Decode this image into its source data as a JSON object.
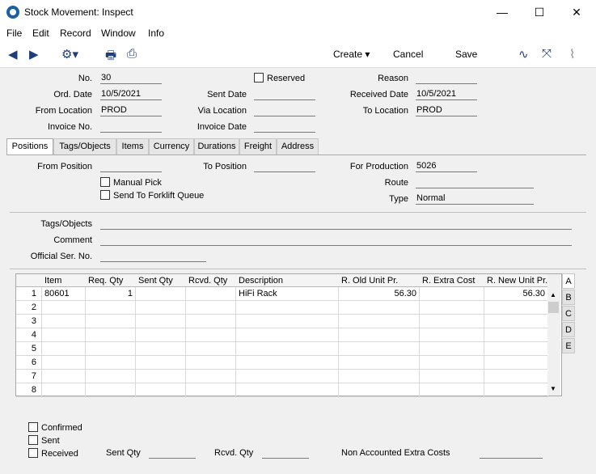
{
  "window": {
    "title": "Stock Movement: Inspect",
    "min": "—",
    "max": "☐",
    "close": "✕"
  },
  "menu": [
    "File",
    "Edit",
    "Record",
    "Window",
    "Info"
  ],
  "toolbar": {
    "create": "Create",
    "cancel": "Cancel",
    "save": "Save"
  },
  "header": {
    "no_label": "No.",
    "no": "30",
    "reserved_label": "Reserved",
    "reason_label": "Reason",
    "reason": "",
    "ord_date_label": "Ord. Date",
    "ord_date": "10/5/2021",
    "sent_date_label": "Sent Date",
    "sent_date": "",
    "received_date_label": "Received Date",
    "received_date": "10/5/2021",
    "from_location_label": "From Location",
    "from_location": "PROD",
    "via_location_label": "Via Location",
    "via_location": "",
    "to_location_label": "To Location",
    "to_location": "PROD",
    "invoice_no_label": "Invoice No.",
    "invoice_no": "",
    "invoice_date_label": "Invoice Date",
    "invoice_date": ""
  },
  "tabs": [
    "Positions",
    "Tags/Objects",
    "Items",
    "Currency",
    "Durations",
    "Freight",
    "Address"
  ],
  "positions": {
    "from_position_label": "From Position",
    "from_position": "",
    "to_position_label": "To Position",
    "to_position": "",
    "for_production_label": "For Production",
    "for_production": "5026",
    "manual_pick_label": "Manual Pick",
    "forklift_label": "Send To Forklift Queue",
    "route_label": "Route",
    "route": "",
    "type_label": "Type",
    "type": "Normal",
    "tags_label": "Tags/Objects",
    "tags": "",
    "comment_label": "Comment",
    "comment": "",
    "official_label": "Official Ser. No.",
    "official": ""
  },
  "grid": {
    "columns": [
      "Item",
      "Req. Qty",
      "Sent Qty",
      "Rcvd. Qty",
      "Description",
      "R. Old Unit Pr.",
      "R. Extra Cost",
      "R. New Unit Pr."
    ],
    "rows": [
      {
        "n": "1",
        "item": "80601",
        "req": "1",
        "sent": "",
        "rcvd": "",
        "desc": "HiFi Rack",
        "old": "56.30",
        "extra": "",
        "new": "56.30"
      },
      {
        "n": "2",
        "item": "",
        "req": "",
        "sent": "",
        "rcvd": "",
        "desc": "",
        "old": "",
        "extra": "",
        "new": ""
      },
      {
        "n": "3",
        "item": "",
        "req": "",
        "sent": "",
        "rcvd": "",
        "desc": "",
        "old": "",
        "extra": "",
        "new": ""
      },
      {
        "n": "4",
        "item": "",
        "req": "",
        "sent": "",
        "rcvd": "",
        "desc": "",
        "old": "",
        "extra": "",
        "new": ""
      },
      {
        "n": "5",
        "item": "",
        "req": "",
        "sent": "",
        "rcvd": "",
        "desc": "",
        "old": "",
        "extra": "",
        "new": ""
      },
      {
        "n": "6",
        "item": "",
        "req": "",
        "sent": "",
        "rcvd": "",
        "desc": "",
        "old": "",
        "extra": "",
        "new": ""
      },
      {
        "n": "7",
        "item": "",
        "req": "",
        "sent": "",
        "rcvd": "",
        "desc": "",
        "old": "",
        "extra": "",
        "new": ""
      },
      {
        "n": "8",
        "item": "",
        "req": "",
        "sent": "",
        "rcvd": "",
        "desc": "",
        "old": "",
        "extra": "",
        "new": ""
      }
    ],
    "side_tabs": [
      "A",
      "B",
      "C",
      "D",
      "E"
    ]
  },
  "footer": {
    "confirmed_label": "Confirmed",
    "sent_label": "Sent",
    "received_label": "Received",
    "sent_qty_label": "Sent Qty",
    "sent_qty": "",
    "rcvd_qty_label": "Rcvd. Qty",
    "rcvd_qty": "",
    "extra_costs_label": "Non Accounted Extra Costs",
    "extra_costs": ""
  },
  "icons": [
    "back-icon",
    "forward-icon",
    "gear-icon",
    "print-icon",
    "print-preview-icon",
    "activity-icon",
    "expand-icon",
    "attachment-icon"
  ]
}
